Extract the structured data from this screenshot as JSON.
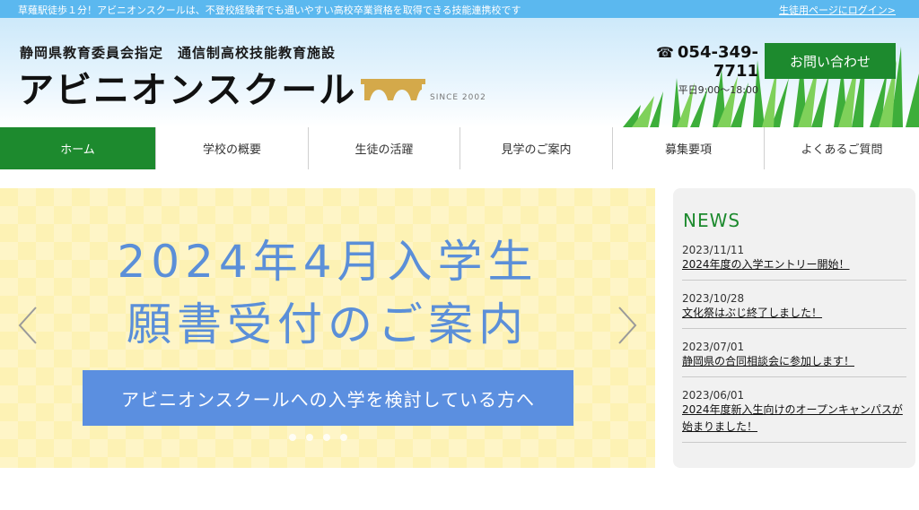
{
  "topbar": {
    "message": "草薙駅徒歩１分！アビニオンスクールは、不登校経験者でも通いやすい高校卒業資格を取得できる技能連携校です",
    "login_link": "生徒用ページにログイン>"
  },
  "header": {
    "subtitle": "静岡県教育委員会指定　通信制高校技能教育施設",
    "school_name": "アビニオンスクール",
    "since": "SINCE 2002",
    "phone": "054-349-7711",
    "hours": "平日9:00～18:00",
    "contact_button": "お問い合わせ",
    "phone_icon": "telephone-icon"
  },
  "nav": {
    "items": [
      {
        "label": "ホーム",
        "active": true
      },
      {
        "label": "学校の概要"
      },
      {
        "label": "生徒の活躍"
      },
      {
        "label": "見学のご案内"
      },
      {
        "label": "募集要項"
      },
      {
        "label": "よくあるご質問"
      }
    ]
  },
  "slider": {
    "headline_line1": "2024年4月入学生",
    "headline_line2": "願書受付のご案内",
    "cta": "アビニオンスクールへの入学を検討している方へ",
    "slide_count": 4
  },
  "news": {
    "heading": "NEWS",
    "entries": [
      {
        "date": "2023/11/11",
        "title": "2024年度の入学エントリー開始！"
      },
      {
        "date": "2023/10/28",
        "title": "文化祭はぶじ終了しました！"
      },
      {
        "date": "2023/07/01",
        "title": "静岡県の合同相談会に参加します！"
      },
      {
        "date": "2023/06/01",
        "title": "2024年度新入生向けのオープンキャンパスが始まりました！"
      }
    ]
  },
  "colors": {
    "topbar": "#5bb8ef",
    "brand_green": "#1d8a2e",
    "slider_text": "#5b8fd8",
    "slider_bg": "#fdf2b4"
  }
}
